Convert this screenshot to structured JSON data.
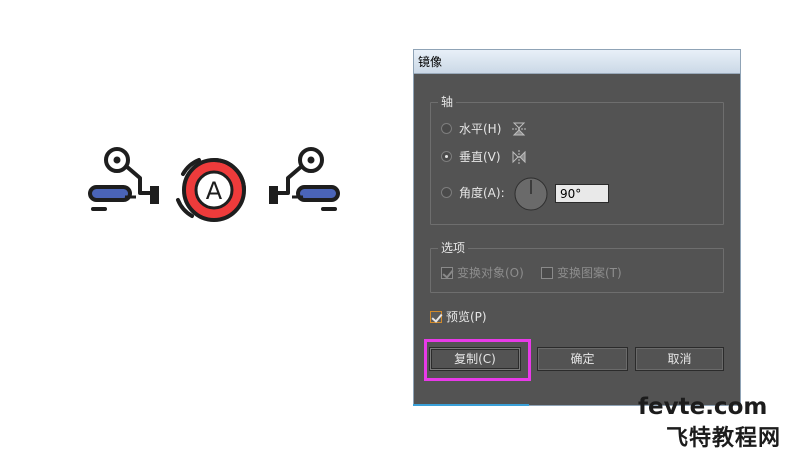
{
  "dialog": {
    "title": "镜像",
    "axis_group": {
      "title": "轴",
      "horizontal_label": "水平(H)",
      "vertical_label": "垂直(V)",
      "angle_label": "角度(A):",
      "angle_value": "90°",
      "selected": "vertical"
    },
    "options_group": {
      "title": "选项",
      "transform_objects_label": "变换对象(O)",
      "transform_objects_checked": true,
      "transform_patterns_label": "变换图案(T)",
      "transform_patterns_checked": false
    },
    "preview_label": "预览(P)",
    "preview_checked": true,
    "buttons": {
      "copy": "复制(C)",
      "ok": "确定",
      "cancel": "取消"
    }
  },
  "illustration": {
    "badge_letter": "A",
    "colors": {
      "outline": "#1e1e1e",
      "accent_red": "#ee3b3b",
      "accent_blue": "#4a64b8"
    }
  },
  "watermark": {
    "domain": "fevte.com",
    "chinese": "飞特教程网"
  },
  "colors": {
    "dialog_bg": "#535353",
    "highlight": "#e83ae8",
    "preview_check": "#d28a2a"
  }
}
